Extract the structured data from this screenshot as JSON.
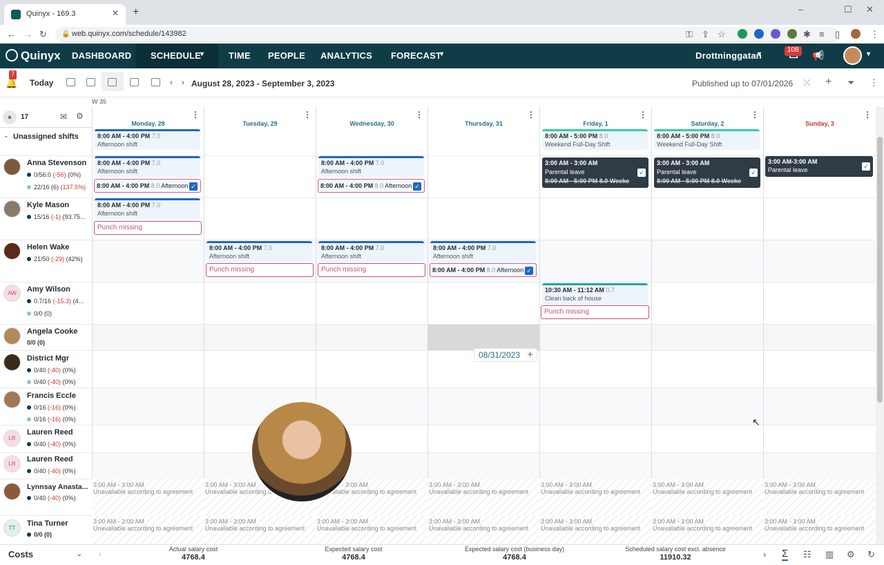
{
  "browser": {
    "tab_title": "Quinyx - 169.3",
    "url": "web.quinyx.com/schedule/143982"
  },
  "nav": {
    "logo": "Quinyx",
    "items": [
      "DASHBOARD",
      "SCHEDULE",
      "TIME",
      "PEOPLE",
      "ANALYTICS",
      "FORECAST"
    ],
    "location": "Drottninggatan",
    "notif_count": "108"
  },
  "toolbar": {
    "bell_count": "7",
    "today": "Today",
    "date_range": "August 28, 2023 - September 3, 2023",
    "published": "Published up to 07/01/2026"
  },
  "week_label": "W 35",
  "employee_count": "17",
  "days": [
    "Monday, 28",
    "Tuesday, 29",
    "Wednesday, 30",
    "Thursday, 31",
    "Friday, 1",
    "Saturday, 2",
    "Sunday, 3"
  ],
  "unassigned_label": "Unassigned shifts",
  "employees": [
    {
      "name": "Anna Stevenson",
      "s1": "0/56.0",
      "s1n": "(-56)",
      "s1p": "(0%)",
      "s2": "22/16 (6)",
      "s2p": "(137.5%)"
    },
    {
      "name": "Kyle Mason",
      "s1": "15/16",
      "s1n": "(-1)",
      "s1p": "(93.75..."
    },
    {
      "name": "Helen Wake",
      "s1": "21/50",
      "s1n": "(-29)",
      "s1p": "(42%)"
    },
    {
      "name": "Amy Wilson",
      "initials": "AW",
      "s1": "0.7/16",
      "s1n": "(-15.3)",
      "s1p": "(4...",
      "s2": "0/0 (0)"
    },
    {
      "name": "Angela Cooke",
      "plain": "0/0 (0)"
    },
    {
      "name": "District Mgr",
      "s1": "0/40",
      "s1n": "(-40)",
      "s1p": "(0%)",
      "s2": "0/40",
      "s2n": "(-40)",
      "s2p": "(0%)"
    },
    {
      "name": "Francis Eccle",
      "s1": "0/16",
      "s1n": "(-16)",
      "s1p": "(0%)",
      "s2": "0/16",
      "s2n": "(-16)",
      "s2p": "(0%)"
    },
    {
      "name": "Lauren Reed",
      "initials": "LR",
      "s1": "0/40",
      "s1n": "(-40)",
      "s1p": "(0%)"
    },
    {
      "name": "Lauren Reed",
      "initials": "LR",
      "s1": "0/40",
      "s1n": "(-40)",
      "s1p": "(0%)"
    },
    {
      "name": "Lynnsay Anasta...",
      "s1": "0/40",
      "s1n": "(-40)",
      "s1p": "(0%)"
    },
    {
      "name": "Tina Turner",
      "initials": "TT",
      "s1": "0/0 (0)"
    }
  ],
  "shifts": {
    "time_8_4": "8:00 AM - 4:00 PM",
    "h7": "7.0",
    "afternoon": "Afternoon shift",
    "time_8_5": "8:00 AM - 5:00 PM",
    "h8": "8.0",
    "weekend": "Weekend Full-Day Shift",
    "row_8_4": "8:00 AM - 4:00 PM",
    "row_h8": "8.0",
    "row_after": "Afternoon",
    "time_3_3": "3:00 AM - 3:00 AM",
    "time_3_3b": "3:00 AM-3:00 AM",
    "parental": "Parental leave",
    "struck": "8:00 AM - 5:00 PM",
    "struck_h": "8.0",
    "struck_l": "Weeke",
    "punch": "Punch missing",
    "time_1030": "10:30 AM - 11:12 AM",
    "h07": "0.7",
    "clean": "Clean back of house",
    "date_pop": "08/31/2023",
    "unavail_time": "3:00 AM - 3:00 AM",
    "unavail": "Unavailable according to agreement"
  },
  "footer": {
    "costs": "Costs",
    "stats": [
      {
        "label": "Actual salary cost",
        "value": "4768.4"
      },
      {
        "label": "Expected salary cost",
        "value": "4768.4"
      },
      {
        "label": "Expected salary cost (business day)",
        "value": "4768.4"
      },
      {
        "label": "Scheduled salary cost excl. absence",
        "value": "11910.32"
      }
    ]
  }
}
